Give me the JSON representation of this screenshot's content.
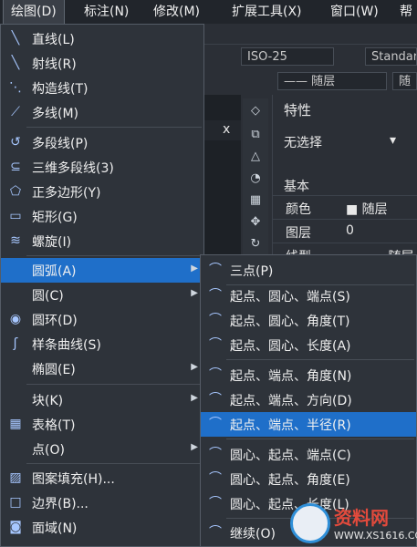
{
  "menubar": {
    "items": [
      {
        "label": "绘图(D)"
      },
      {
        "label": "标注(N)"
      },
      {
        "label": "修改(M)"
      },
      {
        "label": "扩展工具(X)"
      },
      {
        "label": "窗口(W)"
      },
      {
        "label": "帮"
      }
    ]
  },
  "background": {
    "dimstyle": "ISO-25",
    "textstyle": "Standar",
    "layer_bylayer": "—— 随层",
    "layer_right": "随",
    "close_x": "x",
    "props": {
      "title": "特性",
      "selection": "无选择",
      "section": "基本",
      "rows": [
        {
          "key": "颜色",
          "value": "■ 随层"
        },
        {
          "key": "图层",
          "value": "0"
        },
        {
          "key": "线型",
          "value": "——— 随层"
        }
      ]
    }
  },
  "main_menu": {
    "items": [
      {
        "label": "直线(L)",
        "icon": "line-icon"
      },
      {
        "label": "射线(R)",
        "icon": "ray-icon"
      },
      {
        "label": "构造线(T)",
        "icon": "xline-icon"
      },
      {
        "label": "多线(M)",
        "icon": "mline-icon"
      },
      {
        "label": "多段线(P)",
        "icon": "polyline-icon"
      },
      {
        "label": "三维多段线(3)",
        "icon": "3dpoly-icon"
      },
      {
        "label": "正多边形(Y)",
        "icon": "polygon-icon"
      },
      {
        "label": "矩形(G)",
        "icon": "rectangle-icon"
      },
      {
        "label": "螺旋(I)",
        "icon": "helix-icon"
      },
      {
        "label": "圆弧(A)",
        "icon": "",
        "submenu": true
      },
      {
        "label": "圆(C)",
        "icon": "",
        "submenu": true
      },
      {
        "label": "圆环(D)",
        "icon": "donut-icon"
      },
      {
        "label": "样条曲线(S)",
        "icon": "spline-icon"
      },
      {
        "label": "椭圆(E)",
        "icon": "",
        "submenu": true
      },
      {
        "label": "块(K)",
        "icon": "",
        "submenu": true
      },
      {
        "label": "表格(T)",
        "icon": "table-icon"
      },
      {
        "label": "点(O)",
        "icon": "",
        "submenu": true
      },
      {
        "label": "图案填充(H)...",
        "icon": "hatch-icon"
      },
      {
        "label": "边界(B)...",
        "icon": "boundary-icon"
      },
      {
        "label": "面域(N)",
        "icon": "region-icon"
      }
    ]
  },
  "arc_submenu": {
    "items": [
      {
        "label": "三点(P)"
      },
      {
        "label": "起点、圆心、端点(S)"
      },
      {
        "label": "起点、圆心、角度(T)"
      },
      {
        "label": "起点、圆心、长度(A)"
      },
      {
        "label": "起点、端点、角度(N)"
      },
      {
        "label": "起点、端点、方向(D)"
      },
      {
        "label": "起点、端点、半径(R)"
      },
      {
        "label": "圆心、起点、端点(C)"
      },
      {
        "label": "圆心、起点、角度(E)"
      },
      {
        "label": "圆心、起点、长度(L)"
      },
      {
        "label": "继续(O)"
      }
    ]
  },
  "watermark": {
    "title": "资料网",
    "url": "WWW.XS1616.COM"
  },
  "colors": {
    "highlight": "#1f6fc9",
    "menu_bg": "#2e333a",
    "icon": "#a7c7ff"
  }
}
